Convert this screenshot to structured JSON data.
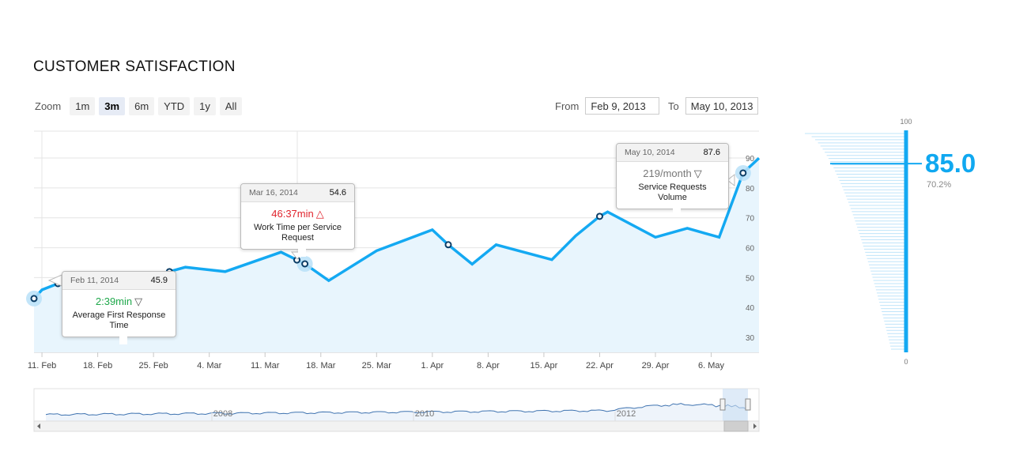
{
  "title": "CUSTOMER SATISFACTION",
  "zoom": {
    "label": "Zoom",
    "buttons": [
      "1m",
      "3m",
      "6m",
      "YTD",
      "1y",
      "All"
    ],
    "active": "3m"
  },
  "range": {
    "from_label": "From",
    "from_value": "Feb 9, 2013",
    "to_label": "To",
    "to_value": "May 10, 2013"
  },
  "colors": {
    "line": "#14a9f2",
    "fill": "#e8f5fd",
    "grid": "#e4e4e4",
    "axis_text": "#666666"
  },
  "tooltips": [
    {
      "date": "Feb 11, 2014",
      "value": "45.9",
      "metric": "2:39min",
      "direction": "down",
      "metric_color": "green",
      "label": "Average First Response Time"
    },
    {
      "date": "Mar 16, 2014",
      "value": "54.6",
      "metric": "46:37min",
      "direction": "up",
      "metric_color": "red",
      "label": "Work Time per Service Request"
    },
    {
      "date": "May 10, 2014",
      "value": "87.6",
      "metric": "219",
      "metric_unit": "/month",
      "direction": "down",
      "metric_color": "gray",
      "label": "Service Requests Volume"
    }
  ],
  "gauge": {
    "value": "85.0",
    "percent": "70.2%",
    "max_label": "100",
    "min_label": "0"
  },
  "chart_data": {
    "type": "area",
    "title": "CUSTOMER SATISFACTION",
    "x_axis": {
      "type": "date",
      "range": [
        "2013-02-10",
        "2013-05-12"
      ],
      "tick_labels": [
        "11. Feb",
        "18. Feb",
        "25. Feb",
        "4. Mar",
        "11. Mar",
        "18. Mar",
        "25. Mar",
        "1. Apr",
        "8. Apr",
        "15. Apr",
        "22. Apr",
        "29. Apr",
        "6. May"
      ],
      "tick_dates": [
        "2013-02-11",
        "2013-02-18",
        "2013-02-25",
        "2013-03-04",
        "2013-03-11",
        "2013-03-18",
        "2013-03-25",
        "2013-04-01",
        "2013-04-08",
        "2013-04-15",
        "2013-04-22",
        "2013-04-29",
        "2013-05-06"
      ]
    },
    "y_axis": {
      "range": [
        25,
        99
      ],
      "ticks": [
        30,
        40,
        50,
        60,
        70,
        80,
        90
      ],
      "position": "right"
    },
    "grid": true,
    "series": [
      {
        "points": [
          [
            "2013-02-10",
            43
          ],
          [
            "2013-02-11",
            45.9
          ],
          [
            "2013-02-13",
            48
          ],
          [
            "2013-02-16",
            49
          ],
          [
            "2013-02-22",
            49.5
          ],
          [
            "2013-02-27",
            52
          ],
          [
            "2013-03-01",
            53.5
          ],
          [
            "2013-03-06",
            52
          ],
          [
            "2013-03-13",
            58.5
          ],
          [
            "2013-03-16",
            54.6
          ],
          [
            "2013-03-19",
            49
          ],
          [
            "2013-03-25",
            59
          ],
          [
            "2013-04-01",
            66
          ],
          [
            "2013-04-03",
            61
          ],
          [
            "2013-04-06",
            54.5
          ],
          [
            "2013-04-09",
            61
          ],
          [
            "2013-04-16",
            56
          ],
          [
            "2013-04-19",
            64
          ],
          [
            "2013-04-22",
            70.5
          ],
          [
            "2013-04-23",
            72
          ],
          [
            "2013-04-29",
            63.5
          ],
          [
            "2013-05-03",
            66.5
          ],
          [
            "2013-05-07",
            63.5
          ],
          [
            "2013-05-10",
            85
          ],
          [
            "2013-05-12",
            90
          ]
        ],
        "markers": [
          "2013-02-10",
          "2013-02-13",
          "2013-02-27",
          "2013-03-15",
          "2013-03-16",
          "2013-04-03",
          "2013-04-22",
          "2013-05-10"
        ],
        "highlighted": [
          "2013-02-10",
          "2013-03-16",
          "2013-05-10"
        ]
      }
    ],
    "navigator": {
      "year_labels": [
        "2008",
        "2010",
        "2012"
      ]
    },
    "gauge_bar": {
      "value": 85.0,
      "max": 100,
      "min": 0
    }
  }
}
